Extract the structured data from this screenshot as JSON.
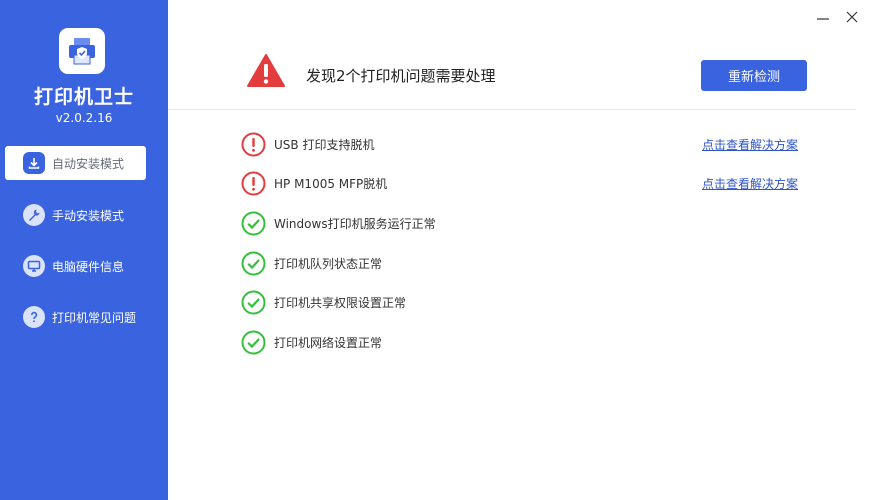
{
  "app": {
    "title": "打印机卫士",
    "version": "v2.0.2.16",
    "logo_icon": "printer-shield-icon"
  },
  "colors": {
    "sidebar_bg": "#3a63e0",
    "accent": "#3a63e0",
    "error": "#e33c3c",
    "ok": "#35bf3a",
    "link": "#2f55c8"
  },
  "sidebar": {
    "items": [
      {
        "label": "自动安装模式",
        "icon": "download-icon",
        "active": true
      },
      {
        "label": "手动安装模式",
        "icon": "wrench-icon",
        "active": false
      },
      {
        "label": "电脑硬件信息",
        "icon": "monitor-icon",
        "active": false
      },
      {
        "label": "打印机常见问题",
        "icon": "question-icon",
        "active": false
      }
    ]
  },
  "window": {
    "minimize_icon": "minimize-icon",
    "close_icon": "close-icon"
  },
  "header": {
    "summary": "发现2个打印机问题需要处理",
    "recheck_label": "重新检测",
    "warning_icon": "warning-icon"
  },
  "checks": [
    {
      "label": "USB 打印支持脱机",
      "status": "error",
      "link": "点击查看解决方案"
    },
    {
      "label": "HP M1005 MFP脱机",
      "status": "error",
      "link": "点击查看解决方案"
    },
    {
      "label": "Windows打印机服务运行正常",
      "status": "ok"
    },
    {
      "label": "打印机队列状态正常",
      "status": "ok"
    },
    {
      "label": "打印机共享权限设置正常",
      "status": "ok"
    },
    {
      "label": "打印机网络设置正常",
      "status": "ok"
    }
  ]
}
